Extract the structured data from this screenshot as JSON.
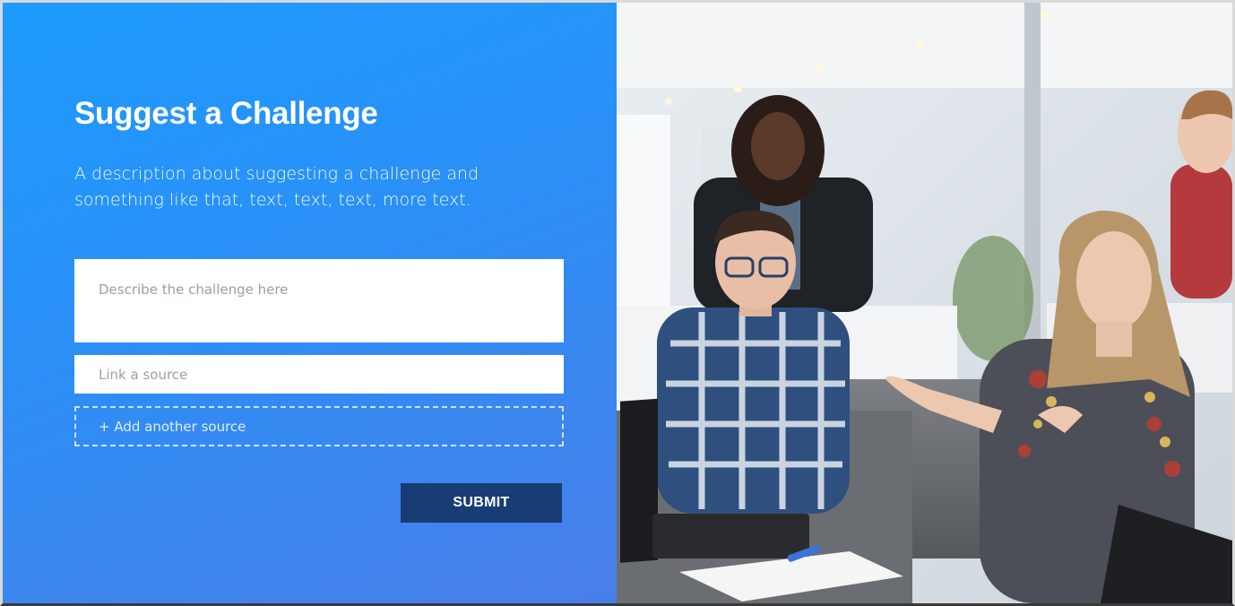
{
  "form": {
    "title": "Suggest a Challenge",
    "description": "A description about suggesting a challenge and something like that, text, text, text, more text.",
    "challenge_placeholder": "Describe the challenge here",
    "source_placeholder": "Link a source",
    "add_source_label": "+ Add another source",
    "submit_label": "SUBMIT"
  },
  "photo": {
    "subject": "people-in-office-meeting"
  },
  "colors": {
    "accent": "#1d9bfd",
    "submit_button": "#1a3c75"
  }
}
